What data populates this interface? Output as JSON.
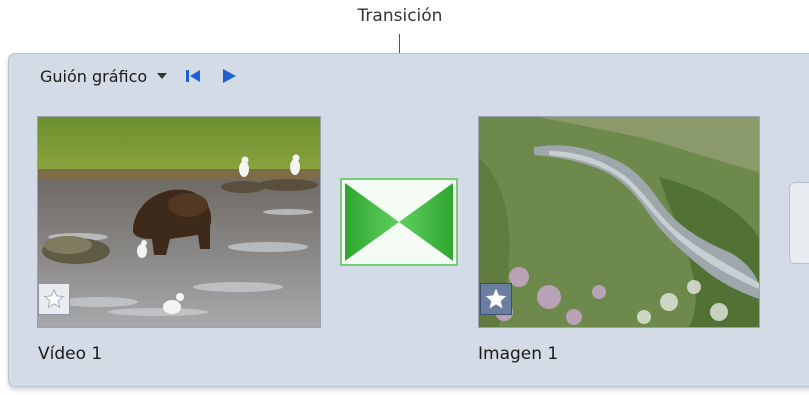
{
  "callout": {
    "label": "Transición"
  },
  "toolbar": {
    "storyboard_label": "Guión gráfico"
  },
  "clips": [
    {
      "caption": "Vídeo 1",
      "starred": false
    },
    {
      "caption": "Imagen 1",
      "starred": true
    }
  ],
  "icons": {
    "dropdown": "chevron-down-icon",
    "previous": "skip-to-start-icon",
    "play": "play-icon",
    "star": "star-icon",
    "transition": "transition-crossfade-icon"
  },
  "colors": {
    "panel_background": "#d2dbe6",
    "toolbar_icon_blue": "#1f5fd1",
    "transition_green": "#3fb83f"
  }
}
